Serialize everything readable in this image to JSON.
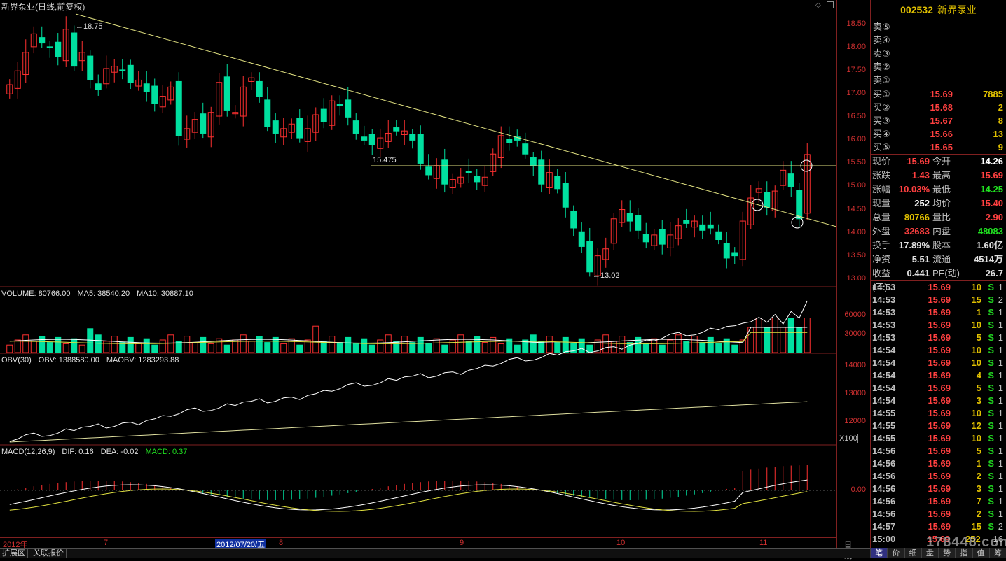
{
  "title": "新界泵业(日线,前复权)",
  "colors": {
    "up": "#ff3030",
    "down": "#00e0a0",
    "ma": "#ffffff",
    "ma10": "#e0e040",
    "line": "#e0e080"
  },
  "price_axis": [
    "18.50",
    "18.00",
    "17.50",
    "17.00",
    "16.50",
    "16.00",
    "15.50",
    "15.00",
    "14.50",
    "14.00",
    "13.50",
    "13.00"
  ],
  "annotations": {
    "high": "18.75",
    "low": "13.02",
    "hline": "15.475"
  },
  "volume": {
    "label": "VOLUME: 80766.00",
    "ma5": "MA5: 38540.20",
    "ma10": "MA10: 30887.10",
    "ticks": [
      "60000",
      "30000"
    ]
  },
  "obv": {
    "label": "OBV(30)",
    "obv": "OBV: 1388580.00",
    "maobv": "MAOBV: 1283293.88",
    "ticks": [
      "14000",
      "13000",
      "12000"
    ],
    "unit": "X100"
  },
  "macd": {
    "label": "MACD(12,26,9)",
    "dif": "DIF: 0.16",
    "dea": "DEA: -0.02",
    "macd": "MACD: 0.37",
    "ticks": [
      "0.00"
    ]
  },
  "xaxis": {
    "labels": [
      "2012年",
      "7",
      "2012/07/20/五",
      "8",
      "9",
      "10",
      "11"
    ],
    "period": "日线"
  },
  "bottom": {
    "tab1": "扩展区",
    "tab2": "关联报价"
  },
  "stock": {
    "code": "002532",
    "name": "新界泵业"
  },
  "sell": [
    {
      "label": "卖⑤",
      "price": "",
      "vol": ""
    },
    {
      "label": "卖④",
      "price": "",
      "vol": ""
    },
    {
      "label": "卖③",
      "price": "",
      "vol": ""
    },
    {
      "label": "卖②",
      "price": "",
      "vol": ""
    },
    {
      "label": "卖①",
      "price": "",
      "vol": ""
    }
  ],
  "buy": [
    {
      "label": "买①",
      "price": "15.69",
      "vol": "7885"
    },
    {
      "label": "买②",
      "price": "15.68",
      "vol": "2"
    },
    {
      "label": "买③",
      "price": "15.67",
      "vol": "8"
    },
    {
      "label": "买④",
      "price": "15.66",
      "vol": "13"
    },
    {
      "label": "买⑤",
      "price": "15.65",
      "vol": "9"
    }
  ],
  "quote": [
    {
      "k": "现价",
      "a": "15.69",
      "k2": "今开",
      "b": "14.26",
      "ac": "#ff4040",
      "bc": "#ffffff"
    },
    {
      "k": "涨跌",
      "a": "1.43",
      "k2": "最高",
      "b": "15.69",
      "ac": "#ff4040",
      "bc": "#ff4040"
    },
    {
      "k": "涨幅",
      "a": "10.03%",
      "k2": "最低",
      "b": "14.25",
      "ac": "#ff4040",
      "bc": "#20e020"
    },
    {
      "k": "现量",
      "a": "252",
      "k2": "均价",
      "b": "15.40",
      "ac": "#ffffff",
      "bc": "#ff4040"
    },
    {
      "k": "总量",
      "a": "80766",
      "k2": "量比",
      "b": "2.90",
      "ac": "#e0c000",
      "bc": "#ff4040"
    },
    {
      "k": "外盘",
      "a": "32683",
      "k2": "内盘",
      "b": "48083",
      "ac": "#ff4040",
      "bc": "#20e020"
    },
    {
      "k": "换手",
      "a": "17.89%",
      "k2": "股本",
      "b": "1.60亿",
      "ac": "#e0e0e0",
      "bc": "#e0e0e0"
    },
    {
      "k": "净资",
      "a": "5.51",
      "k2": "流通",
      "b": "4514万",
      "ac": "#e0e0e0",
      "bc": "#e0e0e0"
    },
    {
      "k": "收益(三)",
      "a": "0.441",
      "k2": "PE(动)",
      "b": "26.7",
      "ac": "#e0e0e0",
      "bc": "#e0e0e0"
    }
  ],
  "ticks": [
    {
      "t": "14:53",
      "p": "15.69",
      "v": "10",
      "s": "S",
      "c": "1"
    },
    {
      "t": "14:53",
      "p": "15.69",
      "v": "15",
      "s": "S",
      "c": "2"
    },
    {
      "t": "14:53",
      "p": "15.69",
      "v": "1",
      "s": "S",
      "c": "1"
    },
    {
      "t": "14:53",
      "p": "15.69",
      "v": "10",
      "s": "S",
      "c": "1"
    },
    {
      "t": "14:53",
      "p": "15.69",
      "v": "5",
      "s": "S",
      "c": "1"
    },
    {
      "t": "14:54",
      "p": "15.69",
      "v": "10",
      "s": "S",
      "c": "1"
    },
    {
      "t": "14:54",
      "p": "15.69",
      "v": "10",
      "s": "S",
      "c": "1"
    },
    {
      "t": "14:54",
      "p": "15.69",
      "v": "4",
      "s": "S",
      "c": "1"
    },
    {
      "t": "14:54",
      "p": "15.69",
      "v": "5",
      "s": "S",
      "c": "1"
    },
    {
      "t": "14:54",
      "p": "15.69",
      "v": "3",
      "s": "S",
      "c": "1"
    },
    {
      "t": "14:55",
      "p": "15.69",
      "v": "10",
      "s": "S",
      "c": "1"
    },
    {
      "t": "14:55",
      "p": "15.69",
      "v": "12",
      "s": "S",
      "c": "1"
    },
    {
      "t": "14:55",
      "p": "15.69",
      "v": "10",
      "s": "S",
      "c": "1"
    },
    {
      "t": "14:56",
      "p": "15.69",
      "v": "5",
      "s": "S",
      "c": "1"
    },
    {
      "t": "14:56",
      "p": "15.69",
      "v": "1",
      "s": "S",
      "c": "1"
    },
    {
      "t": "14:56",
      "p": "15.69",
      "v": "2",
      "s": "S",
      "c": "1"
    },
    {
      "t": "14:56",
      "p": "15.69",
      "v": "3",
      "s": "S",
      "c": "1"
    },
    {
      "t": "14:56",
      "p": "15.69",
      "v": "7",
      "s": "S",
      "c": "1"
    },
    {
      "t": "14:56",
      "p": "15.69",
      "v": "2",
      "s": "S",
      "c": "1"
    },
    {
      "t": "14:57",
      "p": "15.69",
      "v": "15",
      "s": "S",
      "c": "2"
    },
    {
      "t": "15:00",
      "p": "15.69",
      "v": "252",
      "s": "",
      "c": "16"
    }
  ],
  "tabs": [
    "笔",
    "价",
    "细",
    "盘",
    "势",
    "指",
    "值",
    "筹"
  ],
  "watermark": "178448.com"
}
